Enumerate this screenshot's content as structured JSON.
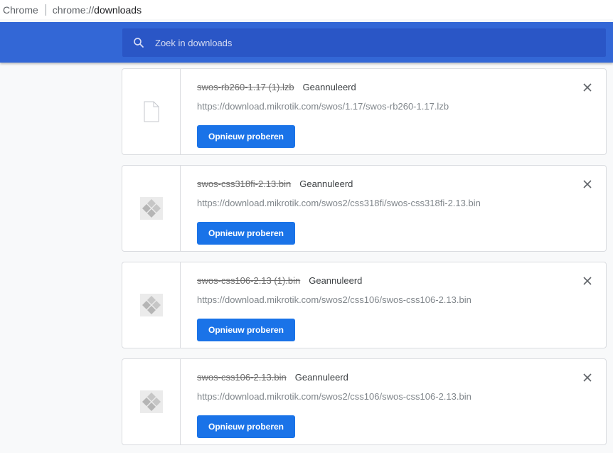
{
  "omnibox": {
    "scheme_label": "Chrome",
    "url_prefix": "chrome://",
    "url_host": "downloads"
  },
  "header": {
    "search_placeholder": "Zoek in downloads"
  },
  "downloads": [
    {
      "file_name": "swos-rb260-1.17 (1).lzb",
      "status": "Geannuleerd",
      "url": "https://download.mikrotik.com/swos/1.17/swos-rb260-1.17.lzb",
      "retry_label": "Opnieuw proberen",
      "icon": "generic-file-icon"
    },
    {
      "file_name": "swos-css318fi-2.13.bin",
      "status": "Geannuleerd",
      "url": "https://download.mikrotik.com/swos2/css318fi/swos-css318fi-2.13.bin",
      "retry_label": "Opnieuw proberen",
      "icon": "kodi-file-icon"
    },
    {
      "file_name": "swos-css106-2.13 (1).bin",
      "status": "Geannuleerd",
      "url": "https://download.mikrotik.com/swos2/css106/swos-css106-2.13.bin",
      "retry_label": "Opnieuw proberen",
      "icon": "kodi-file-icon"
    },
    {
      "file_name": "swos-css106-2.13.bin",
      "status": "Geannuleerd",
      "url": "https://download.mikrotik.com/swos2/css106/swos-css106-2.13.bin",
      "retry_label": "Opnieuw proberen",
      "icon": "kodi-file-icon"
    }
  ],
  "colors": {
    "header_bg": "#3367d6",
    "search_bg": "#2a56c6",
    "button_bg": "#1a73e8",
    "page_bg": "#f8f9fa"
  }
}
